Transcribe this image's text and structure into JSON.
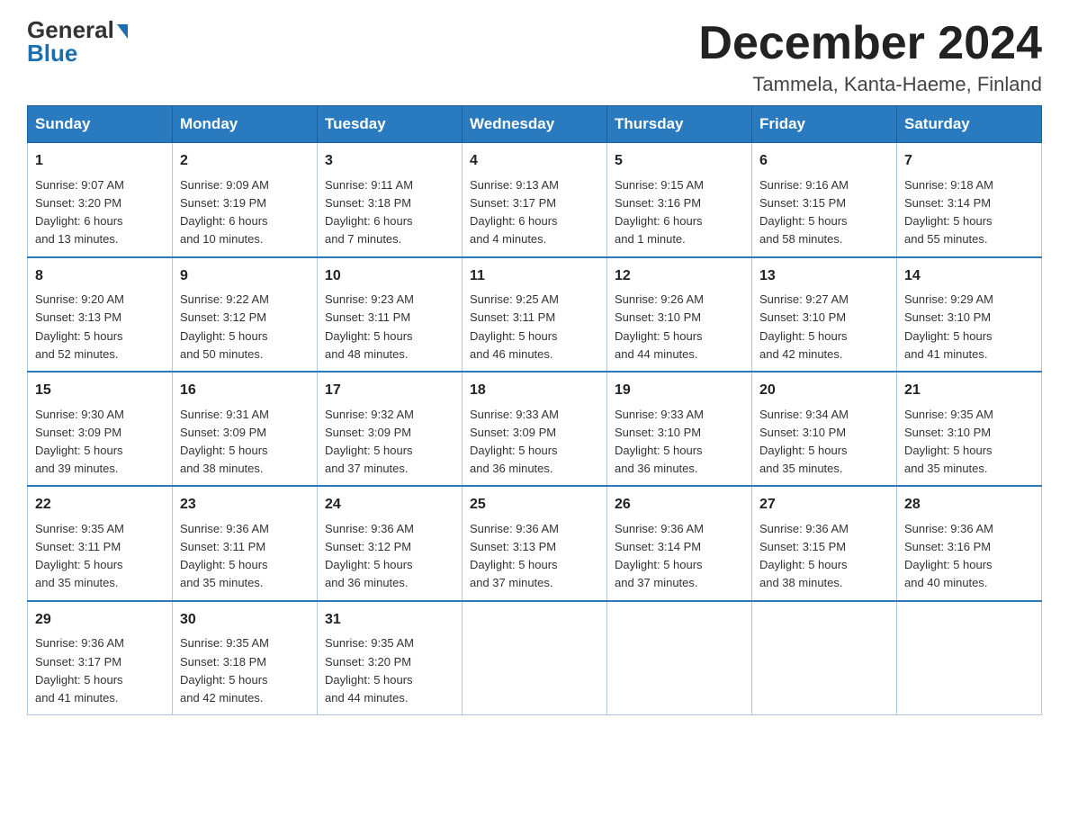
{
  "header": {
    "logo_general": "General",
    "logo_blue": "Blue",
    "month_title": "December 2024",
    "location": "Tammela, Kanta-Haeme, Finland"
  },
  "days_of_week": [
    "Sunday",
    "Monday",
    "Tuesday",
    "Wednesday",
    "Thursday",
    "Friday",
    "Saturday"
  ],
  "weeks": [
    [
      {
        "day": "1",
        "sunrise": "Sunrise: 9:07 AM",
        "sunset": "Sunset: 3:20 PM",
        "daylight": "Daylight: 6 hours",
        "daylight2": "and 13 minutes."
      },
      {
        "day": "2",
        "sunrise": "Sunrise: 9:09 AM",
        "sunset": "Sunset: 3:19 PM",
        "daylight": "Daylight: 6 hours",
        "daylight2": "and 10 minutes."
      },
      {
        "day": "3",
        "sunrise": "Sunrise: 9:11 AM",
        "sunset": "Sunset: 3:18 PM",
        "daylight": "Daylight: 6 hours",
        "daylight2": "and 7 minutes."
      },
      {
        "day": "4",
        "sunrise": "Sunrise: 9:13 AM",
        "sunset": "Sunset: 3:17 PM",
        "daylight": "Daylight: 6 hours",
        "daylight2": "and 4 minutes."
      },
      {
        "day": "5",
        "sunrise": "Sunrise: 9:15 AM",
        "sunset": "Sunset: 3:16 PM",
        "daylight": "Daylight: 6 hours",
        "daylight2": "and 1 minute."
      },
      {
        "day": "6",
        "sunrise": "Sunrise: 9:16 AM",
        "sunset": "Sunset: 3:15 PM",
        "daylight": "Daylight: 5 hours",
        "daylight2": "and 58 minutes."
      },
      {
        "day": "7",
        "sunrise": "Sunrise: 9:18 AM",
        "sunset": "Sunset: 3:14 PM",
        "daylight": "Daylight: 5 hours",
        "daylight2": "and 55 minutes."
      }
    ],
    [
      {
        "day": "8",
        "sunrise": "Sunrise: 9:20 AM",
        "sunset": "Sunset: 3:13 PM",
        "daylight": "Daylight: 5 hours",
        "daylight2": "and 52 minutes."
      },
      {
        "day": "9",
        "sunrise": "Sunrise: 9:22 AM",
        "sunset": "Sunset: 3:12 PM",
        "daylight": "Daylight: 5 hours",
        "daylight2": "and 50 minutes."
      },
      {
        "day": "10",
        "sunrise": "Sunrise: 9:23 AM",
        "sunset": "Sunset: 3:11 PM",
        "daylight": "Daylight: 5 hours",
        "daylight2": "and 48 minutes."
      },
      {
        "day": "11",
        "sunrise": "Sunrise: 9:25 AM",
        "sunset": "Sunset: 3:11 PM",
        "daylight": "Daylight: 5 hours",
        "daylight2": "and 46 minutes."
      },
      {
        "day": "12",
        "sunrise": "Sunrise: 9:26 AM",
        "sunset": "Sunset: 3:10 PM",
        "daylight": "Daylight: 5 hours",
        "daylight2": "and 44 minutes."
      },
      {
        "day": "13",
        "sunrise": "Sunrise: 9:27 AM",
        "sunset": "Sunset: 3:10 PM",
        "daylight": "Daylight: 5 hours",
        "daylight2": "and 42 minutes."
      },
      {
        "day": "14",
        "sunrise": "Sunrise: 9:29 AM",
        "sunset": "Sunset: 3:10 PM",
        "daylight": "Daylight: 5 hours",
        "daylight2": "and 41 minutes."
      }
    ],
    [
      {
        "day": "15",
        "sunrise": "Sunrise: 9:30 AM",
        "sunset": "Sunset: 3:09 PM",
        "daylight": "Daylight: 5 hours",
        "daylight2": "and 39 minutes."
      },
      {
        "day": "16",
        "sunrise": "Sunrise: 9:31 AM",
        "sunset": "Sunset: 3:09 PM",
        "daylight": "Daylight: 5 hours",
        "daylight2": "and 38 minutes."
      },
      {
        "day": "17",
        "sunrise": "Sunrise: 9:32 AM",
        "sunset": "Sunset: 3:09 PM",
        "daylight": "Daylight: 5 hours",
        "daylight2": "and 37 minutes."
      },
      {
        "day": "18",
        "sunrise": "Sunrise: 9:33 AM",
        "sunset": "Sunset: 3:09 PM",
        "daylight": "Daylight: 5 hours",
        "daylight2": "and 36 minutes."
      },
      {
        "day": "19",
        "sunrise": "Sunrise: 9:33 AM",
        "sunset": "Sunset: 3:10 PM",
        "daylight": "Daylight: 5 hours",
        "daylight2": "and 36 minutes."
      },
      {
        "day": "20",
        "sunrise": "Sunrise: 9:34 AM",
        "sunset": "Sunset: 3:10 PM",
        "daylight": "Daylight: 5 hours",
        "daylight2": "and 35 minutes."
      },
      {
        "day": "21",
        "sunrise": "Sunrise: 9:35 AM",
        "sunset": "Sunset: 3:10 PM",
        "daylight": "Daylight: 5 hours",
        "daylight2": "and 35 minutes."
      }
    ],
    [
      {
        "day": "22",
        "sunrise": "Sunrise: 9:35 AM",
        "sunset": "Sunset: 3:11 PM",
        "daylight": "Daylight: 5 hours",
        "daylight2": "and 35 minutes."
      },
      {
        "day": "23",
        "sunrise": "Sunrise: 9:36 AM",
        "sunset": "Sunset: 3:11 PM",
        "daylight": "Daylight: 5 hours",
        "daylight2": "and 35 minutes."
      },
      {
        "day": "24",
        "sunrise": "Sunrise: 9:36 AM",
        "sunset": "Sunset: 3:12 PM",
        "daylight": "Daylight: 5 hours",
        "daylight2": "and 36 minutes."
      },
      {
        "day": "25",
        "sunrise": "Sunrise: 9:36 AM",
        "sunset": "Sunset: 3:13 PM",
        "daylight": "Daylight: 5 hours",
        "daylight2": "and 37 minutes."
      },
      {
        "day": "26",
        "sunrise": "Sunrise: 9:36 AM",
        "sunset": "Sunset: 3:14 PM",
        "daylight": "Daylight: 5 hours",
        "daylight2": "and 37 minutes."
      },
      {
        "day": "27",
        "sunrise": "Sunrise: 9:36 AM",
        "sunset": "Sunset: 3:15 PM",
        "daylight": "Daylight: 5 hours",
        "daylight2": "and 38 minutes."
      },
      {
        "day": "28",
        "sunrise": "Sunrise: 9:36 AM",
        "sunset": "Sunset: 3:16 PM",
        "daylight": "Daylight: 5 hours",
        "daylight2": "and 40 minutes."
      }
    ],
    [
      {
        "day": "29",
        "sunrise": "Sunrise: 9:36 AM",
        "sunset": "Sunset: 3:17 PM",
        "daylight": "Daylight: 5 hours",
        "daylight2": "and 41 minutes."
      },
      {
        "day": "30",
        "sunrise": "Sunrise: 9:35 AM",
        "sunset": "Sunset: 3:18 PM",
        "daylight": "Daylight: 5 hours",
        "daylight2": "and 42 minutes."
      },
      {
        "day": "31",
        "sunrise": "Sunrise: 9:35 AM",
        "sunset": "Sunset: 3:20 PM",
        "daylight": "Daylight: 5 hours",
        "daylight2": "and 44 minutes."
      },
      null,
      null,
      null,
      null
    ]
  ],
  "accent_color": "#2a7abf"
}
